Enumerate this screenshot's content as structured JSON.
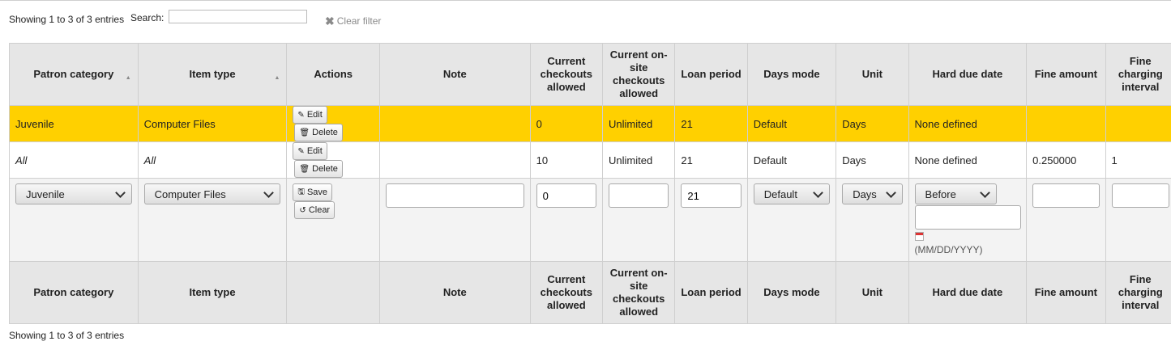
{
  "top": {
    "info": "Showing 1 to 3 of 3 entries",
    "search_label": "Search:",
    "search_value": "",
    "clear_filter": "Clear filter"
  },
  "headers": [
    "Patron category",
    "Item type",
    "Actions",
    "Note",
    "Current checkouts allowed",
    "Current on-site checkouts allowed",
    "Loan period",
    "Days mode",
    "Unit",
    "Hard due date",
    "Fine amount",
    "Fine charging interval"
  ],
  "footer_headers": [
    "Patron category",
    "Item type",
    "",
    "Note",
    "Current checkouts allowed",
    "Current on-site checkouts allowed",
    "Loan period",
    "Days mode",
    "Unit",
    "Hard due date",
    "Fine amount",
    "Fine charging interval"
  ],
  "rows": [
    {
      "patron": "Juvenile",
      "itemtype": "Computer Files",
      "note": "",
      "checkouts": "0",
      "onsite": "Unlimited",
      "loan": "21",
      "daysmode": "Default",
      "unit": "Days",
      "hard_due": "None defined",
      "fine": "",
      "interval": ""
    },
    {
      "patron": "All",
      "itemtype": "All",
      "note": "",
      "checkouts": "10",
      "onsite": "Unlimited",
      "loan": "21",
      "daysmode": "Default",
      "unit": "Days",
      "hard_due": "None defined",
      "fine": "0.250000",
      "interval": "1"
    }
  ],
  "buttons": {
    "edit": "Edit",
    "delete": "Delete",
    "save": "Save",
    "clear": "Clear"
  },
  "edit_row": {
    "patron": "Juvenile",
    "itemtype": "Computer Files",
    "note": "",
    "checkouts": "0",
    "onsite": "",
    "loan": "21",
    "daysmode": "Default",
    "unit": "Days",
    "hard_due_mode": "Before",
    "hard_due_date": "",
    "date_hint": "(MM/DD/YYYY)",
    "fine": "",
    "interval": ""
  },
  "bottom": {
    "info": "Showing 1 to 3 of 3 entries"
  },
  "colors": {
    "highlight": "#ffd000",
    "header_bg": "#e6e6e6"
  }
}
